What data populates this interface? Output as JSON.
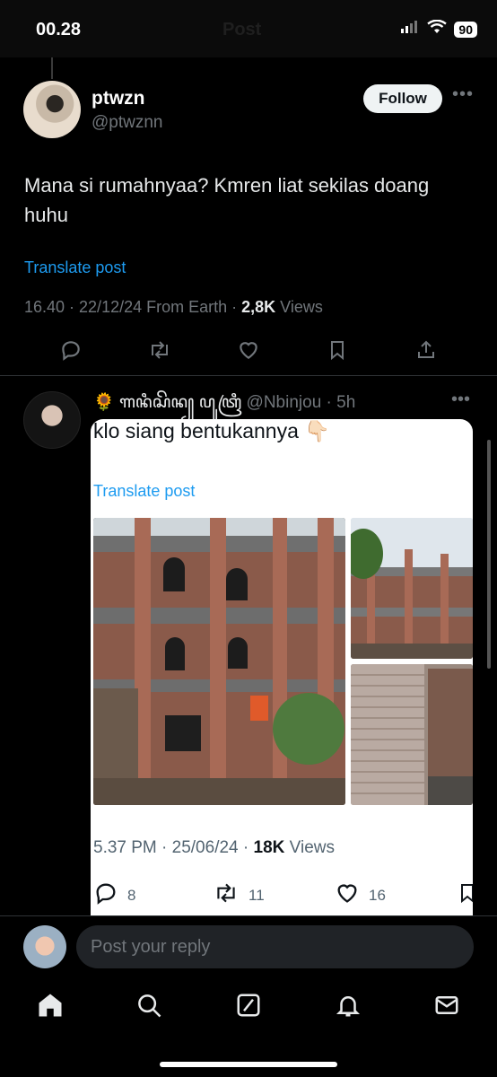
{
  "status": {
    "time": "00.28",
    "title": "Post",
    "battery": "90"
  },
  "author": {
    "name": "ptwzn",
    "handle": "@ptwznn",
    "follow_label": "Follow"
  },
  "post": {
    "text": "Mana si rumahnyaa? Kmren liat sekilas doang huhu",
    "translate_label": "Translate post",
    "time": "16.40 · 22/12/24 From Earth · ",
    "views": "2,8K",
    "views_label": " Views"
  },
  "actions": [
    "reply-icon",
    "retweet-icon",
    "like-icon",
    "bookmark-icon",
    "share-icon"
  ],
  "reply": {
    "emoji": "🌻",
    "name": "ꦒꦤꦶꦱꦼꦤ꧀ ꦥꦸꦠꦿꦶ",
    "handle": "@Nbinjou",
    "time": " · 5h",
    "quoted": {
      "text": "klo siang bentukannya 👇🏻",
      "translate_label": "Translate post",
      "time": "5.37 PM · 25/06/24 · ",
      "views": "18K",
      "views_label": " Views",
      "replies": "8",
      "retweets": "11",
      "likes": "16"
    }
  },
  "reply_bar": {
    "placeholder": "Post your reply"
  },
  "tabs": [
    "home-icon",
    "search-icon",
    "grok-icon",
    "notifications-icon",
    "messages-icon"
  ],
  "colors": {
    "accent": "#1d9bf0",
    "background": "#000000",
    "muted": "#71767b"
  }
}
